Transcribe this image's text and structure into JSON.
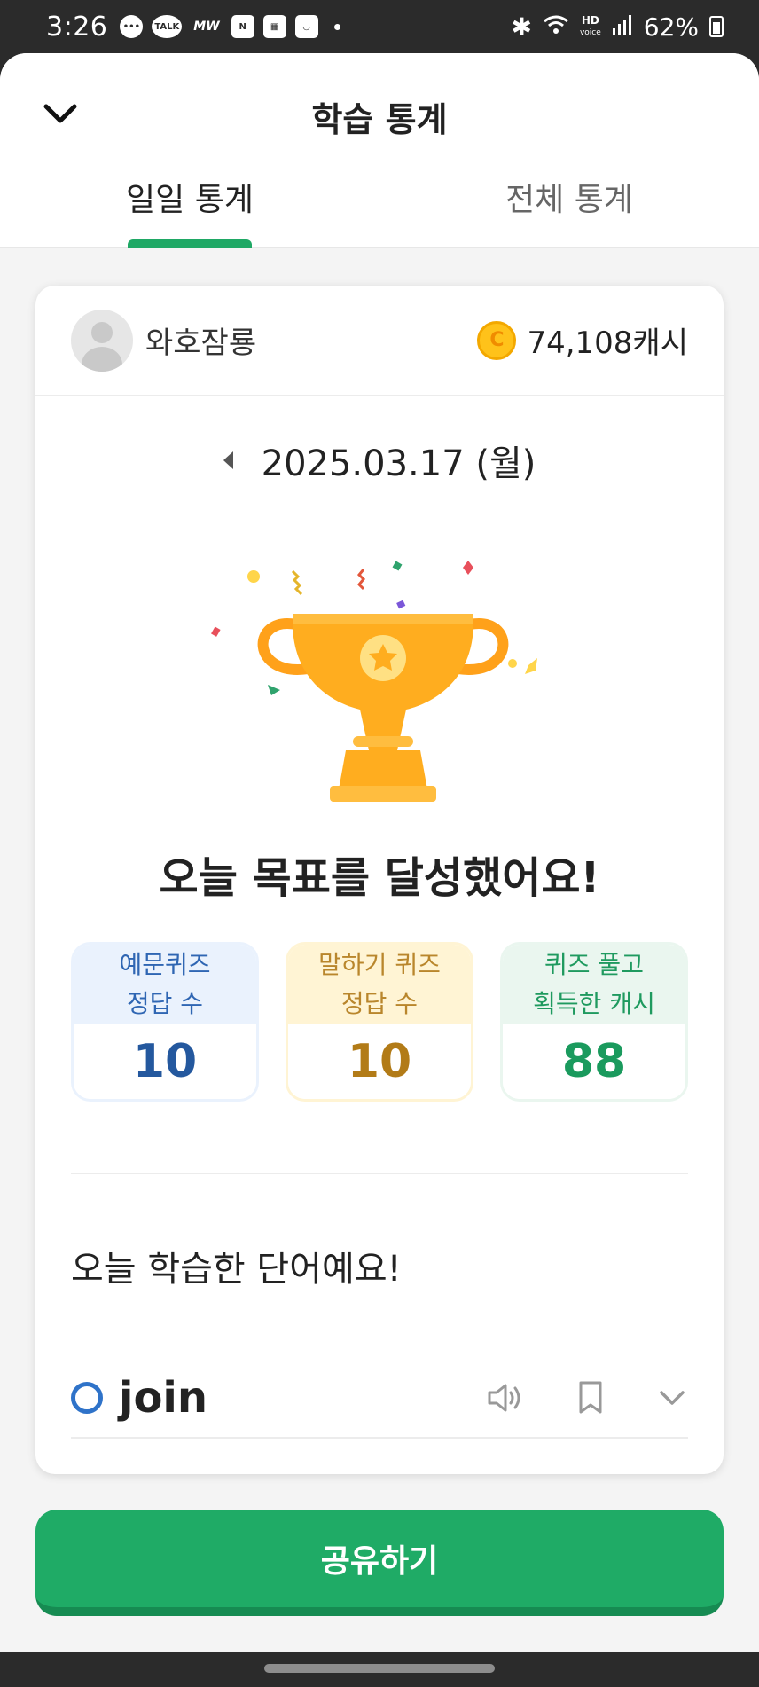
{
  "status_bar": {
    "time": "3:26",
    "app_icons": [
      "chat-icon",
      "talk-icon",
      "mw-icon",
      "notion-icon",
      "widget-icon",
      "baemin-icon"
    ],
    "mw_label": "MW",
    "talk_label": "TALK",
    "notion_label": "N",
    "hd_label": "HD",
    "voice_label": "voice",
    "battery": "62%"
  },
  "header": {
    "title": "학습 통계",
    "tabs": [
      {
        "label": "일일 통계",
        "active": true
      },
      {
        "label": "전체 통계",
        "active": false
      }
    ]
  },
  "profile": {
    "username": "와호잠룡",
    "cash": "74,108캐시",
    "coin_symbol": "C"
  },
  "date": "2025.03.17 (월)",
  "goal_message": "오늘 목표를 달성했어요!",
  "stats": [
    {
      "label_line1": "예문퀴즈",
      "label_line2": "정답 수",
      "value": "10",
      "color": "#2f66b3"
    },
    {
      "label_line1": "말하기 퀴즈",
      "label_line2": "정답 수",
      "value": "10",
      "color": "#b9862c"
    },
    {
      "label_line1": "퀴즈 풀고",
      "label_line2": "획득한 캐시",
      "value": "88",
      "color": "#1f9a5f"
    }
  ],
  "learned": {
    "title": "오늘 학습한 단어예요!",
    "words": [
      {
        "word": "join",
        "status_icon": "circle-icon"
      }
    ]
  },
  "share_button": "공유하기",
  "colors": {
    "accent": "#1fab66",
    "tab_indicator": "#1fa865",
    "trophy": "#ffad1f"
  }
}
